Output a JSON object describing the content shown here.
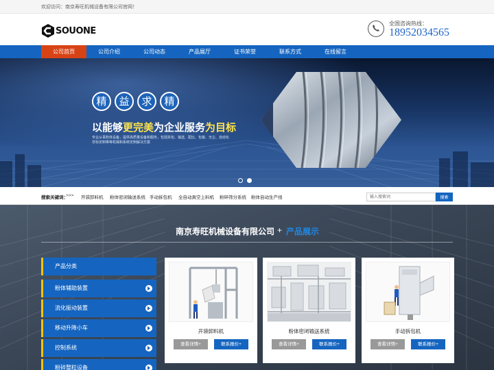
{
  "topbar": {
    "welcome": "欢迎访问：南京寿旺机械设备有限公司官网！"
  },
  "header": {
    "logo_text": "SOUONE",
    "hotline_label": "全国咨询热线：",
    "hotline_number": "18952034565"
  },
  "nav": {
    "items": [
      {
        "label": "公司首页",
        "active": true
      },
      {
        "label": "公司介绍"
      },
      {
        "label": "公司动态"
      },
      {
        "label": "产品展厅"
      },
      {
        "label": "证书荣誉"
      },
      {
        "label": "联系方式"
      },
      {
        "label": "在线留言"
      }
    ]
  },
  "banner": {
    "seal_chars": [
      "精",
      "益",
      "求",
      "精"
    ],
    "slogan_part1": "以能够",
    "slogan_part2": "更完美",
    "slogan_part3": "为企业服务",
    "slogan_part4": "为目标",
    "desc_line1": "专业从事粉体设备，提供高质量设备和服务，包括拆包、输送、配比、包装、无尘、自动化",
    "desc_line2": "非标定制等等机械和系统定制解决方案",
    "slide_count": 2,
    "active_slide": 2
  },
  "keywords": {
    "label": "搜索关键词：",
    "arrow": ">>>",
    "items": [
      "开袋卸料机",
      "粉体密闭输送系统",
      "手动拆包机",
      "全自动真空上料机",
      "粉碎筛分系统",
      "粉体自动生产线"
    ]
  },
  "search": {
    "placeholder": "输入搜索词",
    "button": "搜索"
  },
  "products": {
    "section_title": "南京寿旺机械设备有限公司",
    "plus": "+",
    "section_sub": "产品展示",
    "category_header": "产品分类",
    "categories": [
      "粉体辅助装置",
      "流化振动装置",
      "移动升降小车",
      "控制系统",
      "粉碎整粒设备"
    ],
    "cards": [
      {
        "name": "开袋卸料机",
        "detail": "查看详情+",
        "quote": "联系报价+"
      },
      {
        "name": "粉体密闭输送系统",
        "detail": "查看详情+",
        "quote": "联系报价+"
      },
      {
        "name": "手动拆包机",
        "detail": "查看详情+",
        "quote": "联系报价+"
      }
    ]
  },
  "colors": {
    "primary": "#1565c0",
    "nav_active": "#d84315",
    "accent_yellow": "#ffe34d",
    "category_bar": "#ffc400"
  }
}
